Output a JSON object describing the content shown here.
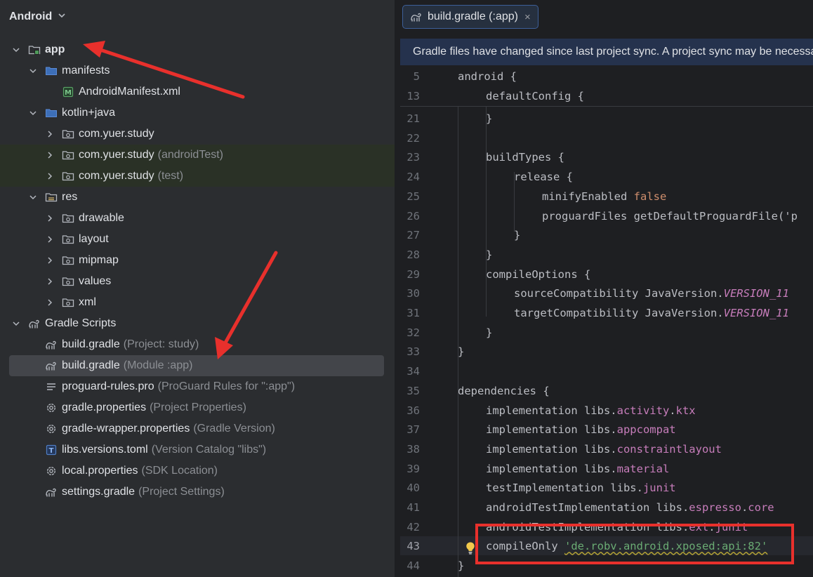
{
  "project_panel": {
    "view_selector": "Android",
    "tree": [
      {
        "id": "app",
        "label": "app",
        "hint": "",
        "expander": "open",
        "icon": "module-folder-icon",
        "bold": true
      },
      {
        "id": "manifests",
        "label": "manifests",
        "hint": "",
        "expander": "open",
        "icon": "folder-icon"
      },
      {
        "id": "manifest-file",
        "label": "AndroidManifest.xml",
        "hint": "",
        "expander": "none",
        "icon": "manifest-file-icon"
      },
      {
        "id": "kotlin-java",
        "label": "kotlin+java",
        "hint": "",
        "expander": "open",
        "icon": "folder-icon"
      },
      {
        "id": "pkg-main",
        "label": "com.yuer.study",
        "hint": "",
        "expander": "closed",
        "icon": "package-icon"
      },
      {
        "id": "pkg-android-test",
        "label": "com.yuer.study",
        "hint": "(androidTest)",
        "expander": "closed",
        "icon": "package-icon",
        "tinted": true
      },
      {
        "id": "pkg-test",
        "label": "com.yuer.study",
        "hint": "(test)",
        "expander": "closed",
        "icon": "package-icon",
        "tinted": true
      },
      {
        "id": "res",
        "label": "res",
        "hint": "",
        "expander": "open",
        "icon": "resource-folder-icon"
      },
      {
        "id": "drawable",
        "label": "drawable",
        "hint": "",
        "expander": "closed",
        "icon": "package-icon"
      },
      {
        "id": "layout",
        "label": "layout",
        "hint": "",
        "expander": "closed",
        "icon": "package-icon"
      },
      {
        "id": "mipmap",
        "label": "mipmap",
        "hint": "",
        "expander": "closed",
        "icon": "package-icon"
      },
      {
        "id": "values",
        "label": "values",
        "hint": "",
        "expander": "closed",
        "icon": "package-icon"
      },
      {
        "id": "xml",
        "label": "xml",
        "hint": "",
        "expander": "closed",
        "icon": "package-icon"
      },
      {
        "id": "gradle-scripts",
        "label": "Gradle Scripts",
        "hint": "",
        "expander": "open",
        "icon": "gradle-icon"
      },
      {
        "id": "build-gradle-project",
        "label": "build.gradle",
        "hint": "(Project: study)",
        "expander": "none",
        "icon": "gradle-icon"
      },
      {
        "id": "build-gradle-module",
        "label": "build.gradle",
        "hint": "(Module :app)",
        "expander": "none",
        "icon": "gradle-icon",
        "selected": true
      },
      {
        "id": "proguard-rules",
        "label": "proguard-rules.pro",
        "hint": "(ProGuard Rules for \":app\")",
        "expander": "none",
        "icon": "text-lines-icon"
      },
      {
        "id": "gradle-properties",
        "label": "gradle.properties",
        "hint": "(Project Properties)",
        "expander": "none",
        "icon": "gear-icon"
      },
      {
        "id": "gradle-wrapper-properties",
        "label": "gradle-wrapper.properties",
        "hint": "(Gradle Version)",
        "expander": "none",
        "icon": "gear-icon"
      },
      {
        "id": "libs-versions",
        "label": "libs.versions.toml",
        "hint": "(Version Catalog \"libs\")",
        "expander": "none",
        "icon": "toml-file-icon"
      },
      {
        "id": "local-properties",
        "label": "local.properties",
        "hint": "(SDK Location)",
        "expander": "none",
        "icon": "gear-icon"
      },
      {
        "id": "settings-gradle",
        "label": "settings.gradle",
        "hint": "(Project Settings)",
        "expander": "none",
        "icon": "gradle-icon"
      }
    ]
  },
  "editor": {
    "tab": {
      "label": "build.gradle (:app)",
      "close_glyph": "×",
      "icon": "gradle-icon"
    },
    "banner": "Gradle files have changed since last project sync. A project sync may be necessary for the IDE to work properly.",
    "sticky_lines": [
      {
        "num": "5",
        "indent": 0,
        "tokens": [
          {
            "t": "android {",
            "c": ""
          }
        ]
      },
      {
        "num": "13",
        "indent": 1,
        "tokens": [
          {
            "t": "defaultConfig {",
            "c": ""
          }
        ]
      }
    ],
    "lines": [
      {
        "num": "21",
        "indent": 1,
        "tokens": [
          {
            "t": "}",
            "c": ""
          }
        ]
      },
      {
        "num": "22",
        "indent": 0,
        "tokens": []
      },
      {
        "num": "23",
        "indent": 1,
        "tokens": [
          {
            "t": "buildTypes {",
            "c": ""
          }
        ]
      },
      {
        "num": "24",
        "indent": 2,
        "tokens": [
          {
            "t": "release {",
            "c": ""
          }
        ]
      },
      {
        "num": "25",
        "indent": 3,
        "tokens": [
          {
            "t": "minifyEnabled ",
            "c": ""
          },
          {
            "t": "false",
            "c": "kw"
          }
        ]
      },
      {
        "num": "26",
        "indent": 3,
        "tokens": [
          {
            "t": "proguardFiles getDefaultProguardFile('p",
            "c": ""
          }
        ]
      },
      {
        "num": "27",
        "indent": 2,
        "tokens": [
          {
            "t": "}",
            "c": ""
          }
        ]
      },
      {
        "num": "28",
        "indent": 1,
        "tokens": [
          {
            "t": "}",
            "c": ""
          }
        ]
      },
      {
        "num": "29",
        "indent": 1,
        "tokens": [
          {
            "t": "compileOptions {",
            "c": ""
          }
        ]
      },
      {
        "num": "30",
        "indent": 2,
        "tokens": [
          {
            "t": "sourceCompatibility JavaVersion.",
            "c": ""
          },
          {
            "t": "VERSION_11",
            "c": "ital"
          }
        ]
      },
      {
        "num": "31",
        "indent": 2,
        "tokens": [
          {
            "t": "targetCompatibility JavaVersion.",
            "c": ""
          },
          {
            "t": "VERSION_11",
            "c": "ital"
          }
        ]
      },
      {
        "num": "32",
        "indent": 1,
        "tokens": [
          {
            "t": "}",
            "c": ""
          }
        ]
      },
      {
        "num": "33",
        "indent": 0,
        "tokens": [
          {
            "t": "}",
            "c": ""
          }
        ]
      },
      {
        "num": "34",
        "indent": 0,
        "tokens": []
      },
      {
        "num": "35",
        "indent": 0,
        "tokens": [
          {
            "t": "dependencies {",
            "c": ""
          }
        ]
      },
      {
        "num": "36",
        "indent": 1,
        "tokens": [
          {
            "t": "implementation libs.",
            "c": ""
          },
          {
            "t": "activity",
            "c": "pur"
          },
          {
            "t": ".",
            "c": ""
          },
          {
            "t": "ktx",
            "c": "pur"
          }
        ]
      },
      {
        "num": "37",
        "indent": 1,
        "tokens": [
          {
            "t": "implementation libs.",
            "c": ""
          },
          {
            "t": "appcompat",
            "c": "pur"
          }
        ]
      },
      {
        "num": "38",
        "indent": 1,
        "tokens": [
          {
            "t": "implementation libs.",
            "c": ""
          },
          {
            "t": "constraintlayout",
            "c": "pur"
          }
        ]
      },
      {
        "num": "39",
        "indent": 1,
        "tokens": [
          {
            "t": "implementation libs.",
            "c": ""
          },
          {
            "t": "material",
            "c": "pur"
          }
        ]
      },
      {
        "num": "40",
        "indent": 1,
        "tokens": [
          {
            "t": "testImplementation libs.",
            "c": ""
          },
          {
            "t": "junit",
            "c": "pur"
          }
        ]
      },
      {
        "num": "41",
        "indent": 1,
        "tokens": [
          {
            "t": "androidTestImplementation libs.",
            "c": ""
          },
          {
            "t": "espresso",
            "c": "pur"
          },
          {
            "t": ".",
            "c": ""
          },
          {
            "t": "core",
            "c": "pur"
          }
        ]
      },
      {
        "num": "42",
        "indent": 1,
        "tokens": [
          {
            "t": "androidTestImplementation libs.",
            "c": ""
          },
          {
            "t": "ext",
            "c": "pur"
          },
          {
            "t": ".",
            "c": ""
          },
          {
            "t": "junit",
            "c": "pur"
          }
        ]
      },
      {
        "num": "43",
        "indent": 1,
        "current": true,
        "tokens": [
          {
            "t": "compileOnly ",
            "c": ""
          },
          {
            "t": "'de.robv.android.xposed:api:82'",
            "c": "str-warn"
          }
        ]
      },
      {
        "num": "44",
        "indent": 0,
        "tokens": [
          {
            "t": "}",
            "c": ""
          }
        ]
      }
    ]
  },
  "annotation_colors": {
    "arrow": "#e8302c",
    "box": "#e8302c"
  }
}
